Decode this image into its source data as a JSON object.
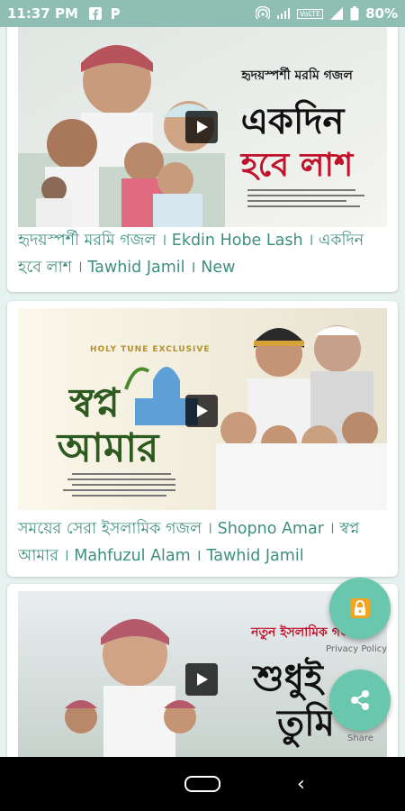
{
  "status_bar": {
    "time": "11:37 PM",
    "left_icons": [
      "facebook-icon",
      "p-app-icon"
    ],
    "network": "VoLTE",
    "battery": "80%"
  },
  "videos": [
    {
      "title": "হৃদয়স্পর্শী মরমি গজল । Ekdin Hobe Lash । একদিন হবে লাশ । Tawhid Jamil । New",
      "thumb_heading": "হৃদয়স্পর্শী মরমি গজল",
      "thumb_big_line1": "একদিন",
      "thumb_big_line2": "হবে লাশ"
    },
    {
      "title": "সময়ের সেরা ইসলামিক গজল । Shopno Amar । স্বপ্ন আমার । Mahfuzul Alam । Tawhid Jamil",
      "thumb_heading": "HOLY TUNE EXCLUSIVE",
      "thumb_big_line1": "স্বপ্ন",
      "thumb_big_line2": "আমার"
    },
    {
      "title": "",
      "thumb_heading": "নতুন ইসলামিক গজল",
      "thumb_big_line1": "শুধুই",
      "thumb_big_line2": "তুমি"
    }
  ],
  "fabs": {
    "privacy_label": "Privacy Policy",
    "share_label": "Share"
  },
  "colors": {
    "accent": "#69c7ad",
    "status_bar": "#8fbfb2",
    "title_text": "#3f8f7e"
  }
}
